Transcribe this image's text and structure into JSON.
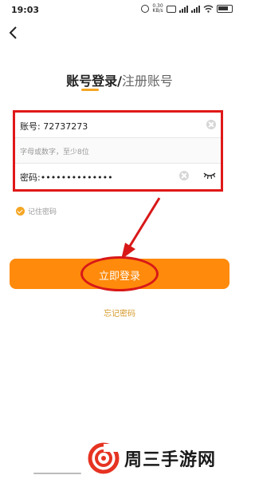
{
  "status_bar": {
    "time": "19:03",
    "net_speed": "0.30\nKB/s",
    "icons": [
      "alarm-icon",
      "net-speed-icon",
      "hd-icon",
      "signal-4g-icon",
      "signal-5g-icon",
      "wifi-icon",
      "battery-icon"
    ]
  },
  "nav": {
    "back_icon": "chevron-left-icon"
  },
  "tabs": {
    "login": "账号登录",
    "separator": "/",
    "register": "注册账号"
  },
  "form": {
    "account_label": "账号:",
    "account_value": "72737273",
    "hint": "字母或数字，至少8位",
    "password_label": "密码:",
    "password_value": "••••••••••••••",
    "icons": [
      "clear-icon",
      "clear-icon",
      "eye-closed-icon"
    ]
  },
  "remember": {
    "label": "记住密码",
    "checked": true
  },
  "login_button": {
    "label": "立即登录"
  },
  "forgot": {
    "label": "忘记密码"
  },
  "watermark": {
    "text": "周三手游网"
  },
  "colors": {
    "accent": "#ff8a0b",
    "annotation": "#d81818",
    "underline": "#f5a623",
    "link": "#d59a2a"
  }
}
